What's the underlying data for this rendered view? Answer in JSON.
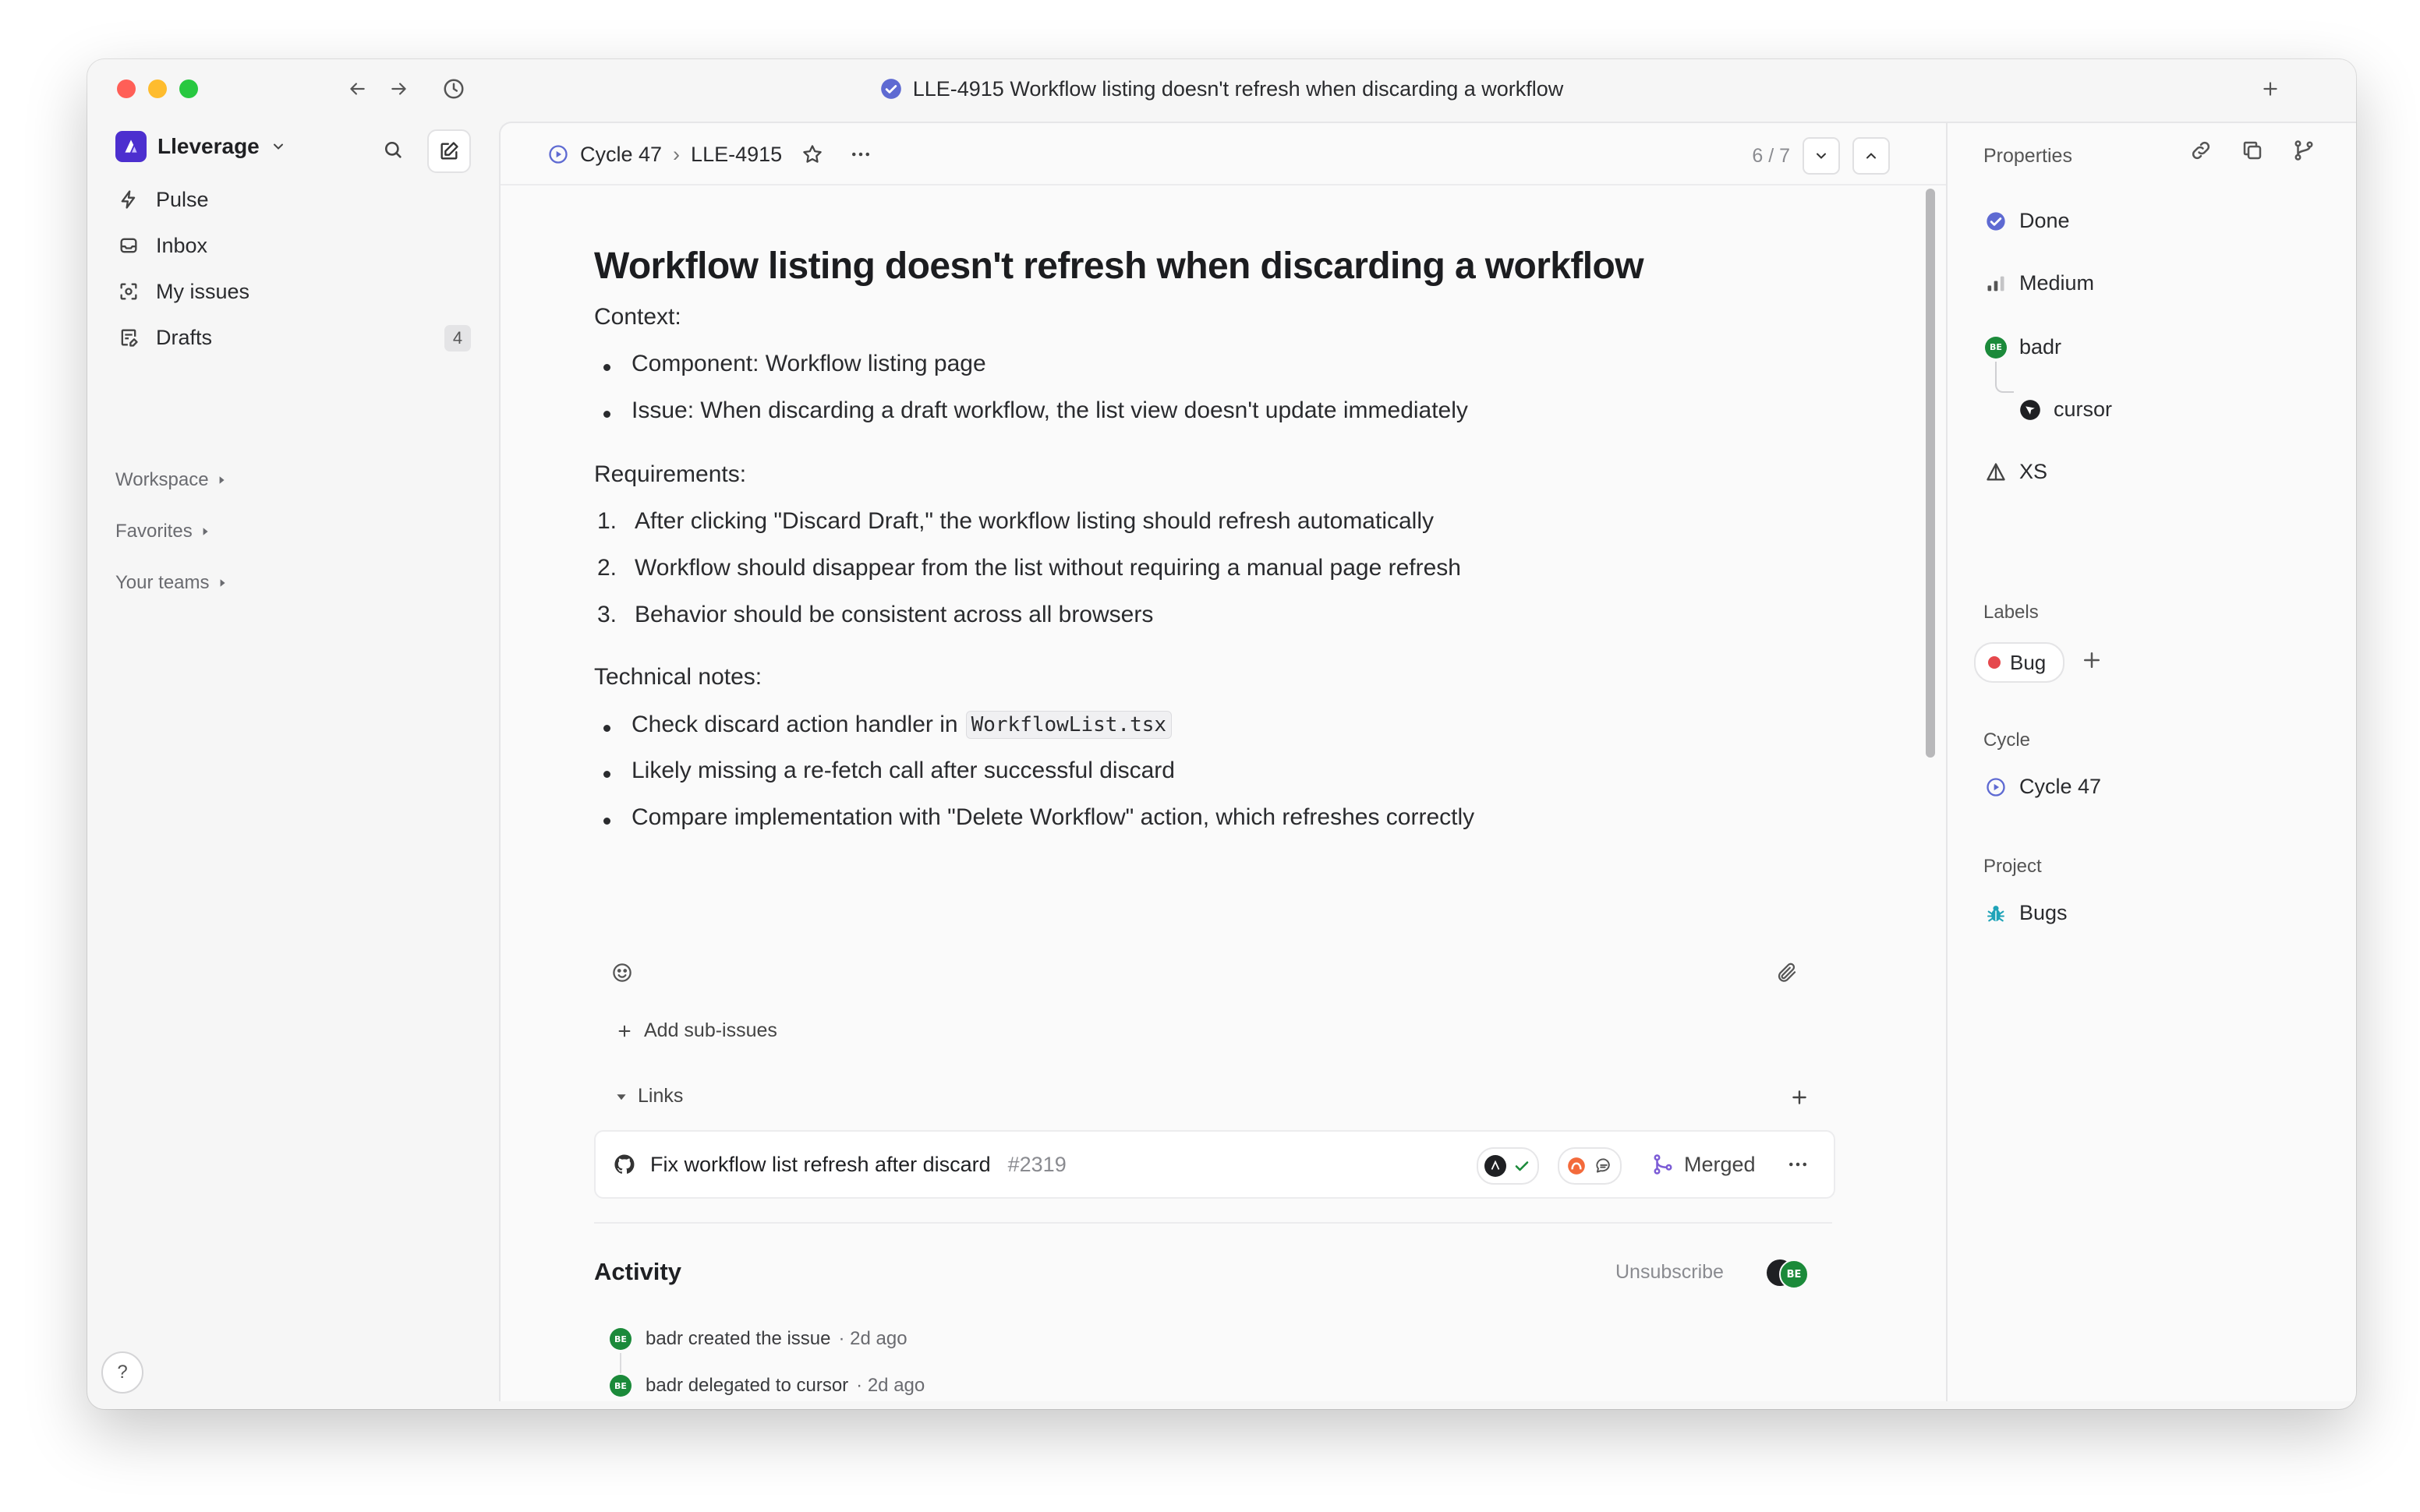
{
  "window": {
    "title": "LLE-4915 Workflow listing doesn't refresh when discarding a workflow"
  },
  "sidebar": {
    "workspace_name": "Lleverage",
    "nav": [
      {
        "label": "Pulse",
        "icon": "pulse-icon"
      },
      {
        "label": "Inbox",
        "icon": "inbox-icon"
      },
      {
        "label": "My issues",
        "icon": "my-issues-icon"
      },
      {
        "label": "Drafts",
        "icon": "drafts-icon",
        "count": "4"
      }
    ],
    "sections": [
      "Workspace",
      "Favorites",
      "Your teams"
    ],
    "help_label": "?"
  },
  "breadcrumb": {
    "cycle": "Cycle 47",
    "separator": "›",
    "issue_id": "LLE-4915"
  },
  "pager": {
    "text": "6 / 7"
  },
  "issue": {
    "title": "Workflow listing doesn't refresh when discarding a workflow",
    "context_heading": "Context:",
    "context_items": [
      "Component: Workflow listing page",
      "Issue: When discarding a draft workflow, the list view doesn't update immediately"
    ],
    "requirements_heading": "Requirements:",
    "requirements": [
      {
        "num": "1.",
        "text": "After clicking \"Discard Draft,\" the workflow listing should refresh automatically"
      },
      {
        "num": "2.",
        "text": "Workflow should disappear from the list without requiring a manual page refresh"
      },
      {
        "num": "3.",
        "text": "Behavior should be consistent across all browsers"
      }
    ],
    "tech_heading": "Technical notes:",
    "tech_items": [
      {
        "text": "Check discard action handler in",
        "code": "WorkflowList.tsx"
      },
      {
        "text": "Likely missing a re-fetch call after successful discard"
      },
      {
        "text": "Compare implementation with \"Delete Workflow\" action, which refreshes correctly"
      }
    ],
    "add_subissues": "Add sub-issues",
    "links_heading": "Links",
    "link": {
      "title": "Fix workflow list refresh after discard",
      "number": "#2319",
      "status": "Merged"
    }
  },
  "activity": {
    "heading": "Activity",
    "unsubscribe": "Unsubscribe",
    "avatar_initials": "BE",
    "events": [
      {
        "text": "badr created the issue",
        "time": "· 2d ago"
      },
      {
        "text": "badr delegated to cursor",
        "time": "· 2d ago"
      }
    ]
  },
  "properties": {
    "heading": "Properties",
    "status": "Done",
    "priority": "Medium",
    "assignee": "badr",
    "assignee_initials": "BE",
    "delegate": "cursor",
    "estimate": "XS",
    "labels_heading": "Labels",
    "labels": [
      "Bug"
    ],
    "cycle_heading": "Cycle",
    "cycle": "Cycle 47",
    "project_heading": "Project",
    "project": "Bugs"
  },
  "colors": {
    "accent": "#5e6ad2",
    "done": "#5e6ad2",
    "bug_label": "#e5484d",
    "avatar": "#1b8a3a",
    "merged": "#7c5cd6"
  }
}
